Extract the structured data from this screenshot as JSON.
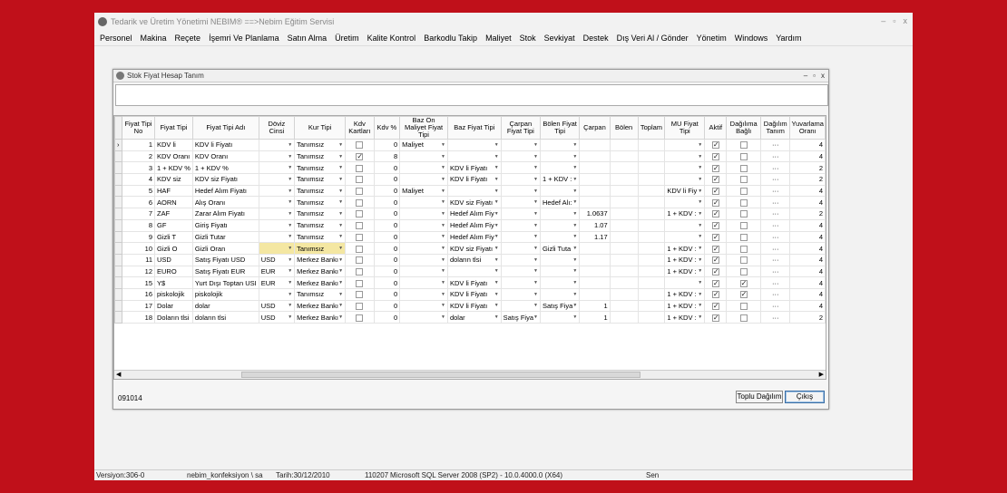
{
  "app": {
    "title": "Tedarik ve Üretim Yönetimi    NEBIM®  ==>Nebim Eğitim Servisi",
    "window_controls": [
      "–",
      "▫",
      "x"
    ]
  },
  "menu": [
    "Personel",
    "Makina",
    "Reçete",
    "İşemri Ve Planlama",
    "Satın Alma",
    "Üretim",
    "Kalite Kontrol",
    "Barkodlu Takip",
    "Maliyet",
    "Stok",
    "Sevkiyat",
    "Destek",
    "Dış Veri Al / Gönder",
    "Yönetim",
    "Windows",
    "Yardım"
  ],
  "dialog": {
    "title": "Stok Fiyat Hesap Tanım",
    "controls": [
      "–",
      "▫",
      "x"
    ],
    "footer_code": "091014",
    "btn_distribution": "Toplu Dağılım",
    "btn_exit": "Çıkış"
  },
  "grid": {
    "columns": [
      "Fiyat Tipi No",
      "Fiyat Tipi",
      "Fiyat Tipi Adı",
      "Döviz Cinsi",
      "Kur Tipi",
      "Kdv Kartları",
      "Kdv %",
      "Baz Ön Maliyet Fiyat Tipi",
      "Baz Fiyat Tipi",
      "Çarpan Fiyat Tipi",
      "Bölen Fiyat Tipi",
      "Çarpan",
      "Bölen",
      "Toplam",
      "MU Fiyat Tipi",
      "Aktif",
      "Dağılıma Bağlı",
      "Dağılım Tanım",
      "Yuvarlama Oranı"
    ],
    "rows": [
      {
        "no": "1",
        "tip": "KDV li",
        "ad": "KDV li Fiyatı",
        "doviz": "",
        "kur": "Tanımsız",
        "kdvk": false,
        "kdv": "0",
        "baz_on": "Maliyet",
        "baz": "",
        "carpan_t": "",
        "bolen_t": "",
        "carpan": "",
        "bolen": "",
        "toplam": "",
        "mu": "",
        "aktif": true,
        "dag": false,
        "dagt": "···",
        "yuv": "4"
      },
      {
        "no": "2",
        "tip": "KDV Oranı",
        "ad": "KDV Oranı",
        "doviz": "",
        "kur": "Tanımsız",
        "kdvk": true,
        "kdv": "8",
        "baz_on": "",
        "baz": "",
        "carpan_t": "",
        "bolen_t": "",
        "carpan": "",
        "bolen": "",
        "toplam": "",
        "mu": "",
        "aktif": true,
        "dag": false,
        "dagt": "···",
        "yuv": "4"
      },
      {
        "no": "3",
        "tip": "1 + KDV %",
        "ad": "1 + KDV %",
        "doviz": "",
        "kur": "Tanımsız",
        "kdvk": false,
        "kdv": "0",
        "baz_on": "",
        "baz": "KDV li Fiyatı",
        "carpan_t": "",
        "bolen_t": "",
        "carpan": "",
        "bolen": "",
        "toplam": "",
        "mu": "",
        "aktif": true,
        "dag": false,
        "dagt": "···",
        "yuv": "2"
      },
      {
        "no": "4",
        "tip": "KDV siz",
        "ad": "KDV siz Fiyatı",
        "doviz": "",
        "kur": "Tanımsız",
        "kdvk": false,
        "kdv": "0",
        "baz_on": "",
        "baz": "KDV li Fiyatı",
        "carpan_t": "",
        "bolen_t": "1 + KDV :",
        "carpan": "",
        "bolen": "",
        "toplam": "",
        "mu": "",
        "aktif": true,
        "dag": false,
        "dagt": "···",
        "yuv": "2"
      },
      {
        "no": "5",
        "tip": "HAF",
        "ad": "Hedef Alım Fiyatı",
        "doviz": "",
        "kur": "Tanımsız",
        "kdvk": false,
        "kdv": "0",
        "baz_on": "Maliyet",
        "baz": "",
        "carpan_t": "",
        "bolen_t": "",
        "carpan": "",
        "bolen": "",
        "toplam": "",
        "mu": "KDV li Fiy",
        "aktif": true,
        "dag": false,
        "dagt": "···",
        "yuv": "4"
      },
      {
        "no": "6",
        "tip": "AORN",
        "ad": "Alış Oranı",
        "doviz": "",
        "kur": "Tanımsız",
        "kdvk": false,
        "kdv": "0",
        "baz_on": "",
        "baz": "KDV siz Fiyatı",
        "carpan_t": "",
        "bolen_t": "Hedef Alı:",
        "carpan": "",
        "bolen": "",
        "toplam": "",
        "mu": "",
        "aktif": true,
        "dag": false,
        "dagt": "···",
        "yuv": "4"
      },
      {
        "no": "7",
        "tip": "ZAF",
        "ad": "Zarar Alım Fiyatı",
        "doviz": "",
        "kur": "Tanımsız",
        "kdvk": false,
        "kdv": "0",
        "baz_on": "",
        "baz": "Hedef Alım Fiy",
        "carpan_t": "",
        "bolen_t": "",
        "carpan": "1.0637",
        "bolen": "",
        "toplam": "",
        "mu": "1 + KDV :",
        "aktif": true,
        "dag": false,
        "dagt": "···",
        "yuv": "2"
      },
      {
        "no": "8",
        "tip": "GF",
        "ad": "Giriş Fiyatı",
        "doviz": "",
        "kur": "Tanımsız",
        "kdvk": false,
        "kdv": "0",
        "baz_on": "",
        "baz": "Hedef Alım Fiy",
        "carpan_t": "",
        "bolen_t": "",
        "carpan": "1.07",
        "bolen": "",
        "toplam": "",
        "mu": "",
        "aktif": true,
        "dag": false,
        "dagt": "···",
        "yuv": "4"
      },
      {
        "no": "9",
        "tip": "Gizli T",
        "ad": "Gizli Tutar",
        "doviz": "",
        "kur": "Tanımsız",
        "kdvk": false,
        "kdv": "0",
        "baz_on": "",
        "baz": "Hedef Alım Fiy",
        "carpan_t": "",
        "bolen_t": "",
        "carpan": "1.17",
        "bolen": "",
        "toplam": "",
        "mu": "",
        "aktif": true,
        "dag": false,
        "dagt": "···",
        "yuv": "4"
      },
      {
        "no": "10",
        "tip": "Gizli O",
        "ad": "Gizli Oran",
        "doviz": "",
        "kur": "Tanımsız",
        "kdvk": false,
        "kdv": "0",
        "baz_on": "",
        "baz": "KDV siz Fiyatı",
        "carpan_t": "",
        "bolen_t": "Gizli Tuta",
        "carpan": "",
        "bolen": "",
        "toplam": "",
        "mu": "1 + KDV :",
        "aktif": true,
        "dag": false,
        "dagt": "···",
        "yuv": "4",
        "hl": true
      },
      {
        "no": "11",
        "tip": "USD",
        "ad": "Satış Fiyatı USD",
        "doviz": "USD",
        "kur": "Merkez Bankı",
        "kdvk": false,
        "kdv": "0",
        "baz_on": "",
        "baz": "doların tlsi",
        "carpan_t": "",
        "bolen_t": "",
        "carpan": "",
        "bolen": "",
        "toplam": "",
        "mu": "1 + KDV :",
        "aktif": true,
        "dag": false,
        "dagt": "···",
        "yuv": "4"
      },
      {
        "no": "12",
        "tip": "EURO",
        "ad": "Satış Fiyatı EUR",
        "doviz": "EUR",
        "kur": "Merkez Bankı",
        "kdvk": false,
        "kdv": "0",
        "baz_on": "",
        "baz": "",
        "carpan_t": "",
        "bolen_t": "",
        "carpan": "",
        "bolen": "",
        "toplam": "",
        "mu": "1 + KDV :",
        "aktif": true,
        "dag": false,
        "dagt": "···",
        "yuv": "4"
      },
      {
        "no": "15",
        "tip": "Y$",
        "ad": "Yurt Dışı Toptan USI",
        "doviz": "EUR",
        "kur": "Merkez Bankı",
        "kdvk": false,
        "kdv": "0",
        "baz_on": "",
        "baz": "KDV li Fiyatı",
        "carpan_t": "",
        "bolen_t": "",
        "carpan": "",
        "bolen": "",
        "toplam": "",
        "mu": "",
        "aktif": true,
        "dag": true,
        "dagt": "···",
        "yuv": "4"
      },
      {
        "no": "16",
        "tip": "piskolojik",
        "ad": "piskolojik",
        "doviz": "",
        "kur": "Tanımsız",
        "kdvk": false,
        "kdv": "0",
        "baz_on": "",
        "baz": "KDV li Fiyatı",
        "carpan_t": "",
        "bolen_t": "",
        "carpan": "",
        "bolen": "",
        "toplam": "",
        "mu": "1 + KDV :",
        "aktif": true,
        "dag": true,
        "dagt": "···",
        "yuv": "4"
      },
      {
        "no": "17",
        "tip": "Dolar",
        "ad": "dolar",
        "doviz": "USD",
        "kur": "Merkez Bankı",
        "kdvk": false,
        "kdv": "0",
        "baz_on": "",
        "baz": "KDV li Fiyatı",
        "carpan_t": "",
        "bolen_t": "Satış Fiya",
        "carpan": "1",
        "bolen": "",
        "toplam": "",
        "mu": "1 + KDV :",
        "aktif": true,
        "dag": false,
        "dagt": "···",
        "yuv": "4"
      },
      {
        "no": "18",
        "tip": "Doların tlsi",
        "ad": "doların tlsi",
        "doviz": "USD",
        "kur": "Merkez Bankı",
        "kdvk": false,
        "kdv": "0",
        "baz_on": "",
        "baz": "dolar",
        "carpan_t": "Satış Fiya",
        "bolen_t": "",
        "carpan": "1",
        "bolen": "",
        "toplam": "",
        "mu": "1 + KDV :",
        "aktif": true,
        "dag": false,
        "dagt": "···",
        "yuv": "2"
      }
    ]
  },
  "status": [
    "Versiyon:306-0",
    "nebim_konfeksiyon \\ sa",
    "Tarih:30/12/2010",
    "110207",
    "Microsoft SQL Server 2008 (SP2) - 10.0.4000.0 (X64)",
    "Sen"
  ]
}
